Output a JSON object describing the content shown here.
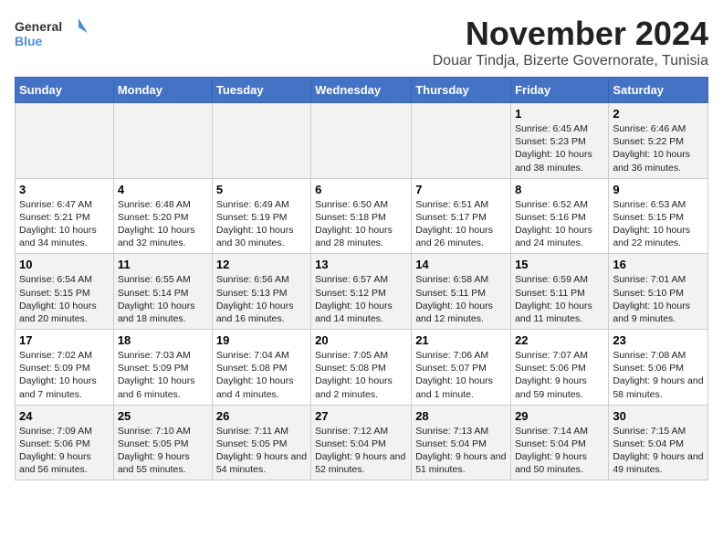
{
  "logo": {
    "line1": "General",
    "line2": "Blue"
  },
  "title": "November 2024",
  "subtitle": "Douar Tindja, Bizerte Governorate, Tunisia",
  "days_of_week": [
    "Sunday",
    "Monday",
    "Tuesday",
    "Wednesday",
    "Thursday",
    "Friday",
    "Saturday"
  ],
  "weeks": [
    [
      {
        "day": "",
        "info": ""
      },
      {
        "day": "",
        "info": ""
      },
      {
        "day": "",
        "info": ""
      },
      {
        "day": "",
        "info": ""
      },
      {
        "day": "",
        "info": ""
      },
      {
        "day": "1",
        "info": "Sunrise: 6:45 AM\nSunset: 5:23 PM\nDaylight: 10 hours and 38 minutes."
      },
      {
        "day": "2",
        "info": "Sunrise: 6:46 AM\nSunset: 5:22 PM\nDaylight: 10 hours and 36 minutes."
      }
    ],
    [
      {
        "day": "3",
        "info": "Sunrise: 6:47 AM\nSunset: 5:21 PM\nDaylight: 10 hours and 34 minutes."
      },
      {
        "day": "4",
        "info": "Sunrise: 6:48 AM\nSunset: 5:20 PM\nDaylight: 10 hours and 32 minutes."
      },
      {
        "day": "5",
        "info": "Sunrise: 6:49 AM\nSunset: 5:19 PM\nDaylight: 10 hours and 30 minutes."
      },
      {
        "day": "6",
        "info": "Sunrise: 6:50 AM\nSunset: 5:18 PM\nDaylight: 10 hours and 28 minutes."
      },
      {
        "day": "7",
        "info": "Sunrise: 6:51 AM\nSunset: 5:17 PM\nDaylight: 10 hours and 26 minutes."
      },
      {
        "day": "8",
        "info": "Sunrise: 6:52 AM\nSunset: 5:16 PM\nDaylight: 10 hours and 24 minutes."
      },
      {
        "day": "9",
        "info": "Sunrise: 6:53 AM\nSunset: 5:15 PM\nDaylight: 10 hours and 22 minutes."
      }
    ],
    [
      {
        "day": "10",
        "info": "Sunrise: 6:54 AM\nSunset: 5:15 PM\nDaylight: 10 hours and 20 minutes."
      },
      {
        "day": "11",
        "info": "Sunrise: 6:55 AM\nSunset: 5:14 PM\nDaylight: 10 hours and 18 minutes."
      },
      {
        "day": "12",
        "info": "Sunrise: 6:56 AM\nSunset: 5:13 PM\nDaylight: 10 hours and 16 minutes."
      },
      {
        "day": "13",
        "info": "Sunrise: 6:57 AM\nSunset: 5:12 PM\nDaylight: 10 hours and 14 minutes."
      },
      {
        "day": "14",
        "info": "Sunrise: 6:58 AM\nSunset: 5:11 PM\nDaylight: 10 hours and 12 minutes."
      },
      {
        "day": "15",
        "info": "Sunrise: 6:59 AM\nSunset: 5:11 PM\nDaylight: 10 hours and 11 minutes."
      },
      {
        "day": "16",
        "info": "Sunrise: 7:01 AM\nSunset: 5:10 PM\nDaylight: 10 hours and 9 minutes."
      }
    ],
    [
      {
        "day": "17",
        "info": "Sunrise: 7:02 AM\nSunset: 5:09 PM\nDaylight: 10 hours and 7 minutes."
      },
      {
        "day": "18",
        "info": "Sunrise: 7:03 AM\nSunset: 5:09 PM\nDaylight: 10 hours and 6 minutes."
      },
      {
        "day": "19",
        "info": "Sunrise: 7:04 AM\nSunset: 5:08 PM\nDaylight: 10 hours and 4 minutes."
      },
      {
        "day": "20",
        "info": "Sunrise: 7:05 AM\nSunset: 5:08 PM\nDaylight: 10 hours and 2 minutes."
      },
      {
        "day": "21",
        "info": "Sunrise: 7:06 AM\nSunset: 5:07 PM\nDaylight: 10 hours and 1 minute."
      },
      {
        "day": "22",
        "info": "Sunrise: 7:07 AM\nSunset: 5:06 PM\nDaylight: 9 hours and 59 minutes."
      },
      {
        "day": "23",
        "info": "Sunrise: 7:08 AM\nSunset: 5:06 PM\nDaylight: 9 hours and 58 minutes."
      }
    ],
    [
      {
        "day": "24",
        "info": "Sunrise: 7:09 AM\nSunset: 5:06 PM\nDaylight: 9 hours and 56 minutes."
      },
      {
        "day": "25",
        "info": "Sunrise: 7:10 AM\nSunset: 5:05 PM\nDaylight: 9 hours and 55 minutes."
      },
      {
        "day": "26",
        "info": "Sunrise: 7:11 AM\nSunset: 5:05 PM\nDaylight: 9 hours and 54 minutes."
      },
      {
        "day": "27",
        "info": "Sunrise: 7:12 AM\nSunset: 5:04 PM\nDaylight: 9 hours and 52 minutes."
      },
      {
        "day": "28",
        "info": "Sunrise: 7:13 AM\nSunset: 5:04 PM\nDaylight: 9 hours and 51 minutes."
      },
      {
        "day": "29",
        "info": "Sunrise: 7:14 AM\nSunset: 5:04 PM\nDaylight: 9 hours and 50 minutes."
      },
      {
        "day": "30",
        "info": "Sunrise: 7:15 AM\nSunset: 5:04 PM\nDaylight: 9 hours and 49 minutes."
      }
    ]
  ]
}
